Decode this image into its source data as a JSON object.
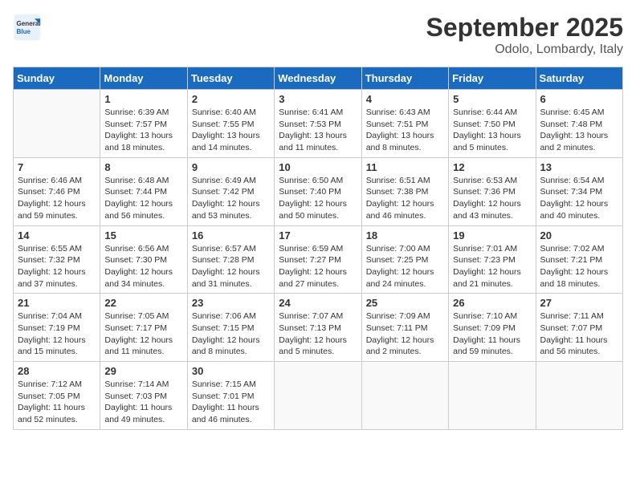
{
  "header": {
    "logo_general": "General",
    "logo_blue": "Blue",
    "month_title": "September 2025",
    "location": "Odolo, Lombardy, Italy"
  },
  "days_of_week": [
    "Sunday",
    "Monday",
    "Tuesday",
    "Wednesday",
    "Thursday",
    "Friday",
    "Saturday"
  ],
  "weeks": [
    [
      {
        "day": "",
        "info": ""
      },
      {
        "day": "1",
        "info": "Sunrise: 6:39 AM\nSunset: 7:57 PM\nDaylight: 13 hours\nand 18 minutes."
      },
      {
        "day": "2",
        "info": "Sunrise: 6:40 AM\nSunset: 7:55 PM\nDaylight: 13 hours\nand 14 minutes."
      },
      {
        "day": "3",
        "info": "Sunrise: 6:41 AM\nSunset: 7:53 PM\nDaylight: 13 hours\nand 11 minutes."
      },
      {
        "day": "4",
        "info": "Sunrise: 6:43 AM\nSunset: 7:51 PM\nDaylight: 13 hours\nand 8 minutes."
      },
      {
        "day": "5",
        "info": "Sunrise: 6:44 AM\nSunset: 7:50 PM\nDaylight: 13 hours\nand 5 minutes."
      },
      {
        "day": "6",
        "info": "Sunrise: 6:45 AM\nSunset: 7:48 PM\nDaylight: 13 hours\nand 2 minutes."
      }
    ],
    [
      {
        "day": "7",
        "info": "Sunrise: 6:46 AM\nSunset: 7:46 PM\nDaylight: 12 hours\nand 59 minutes."
      },
      {
        "day": "8",
        "info": "Sunrise: 6:48 AM\nSunset: 7:44 PM\nDaylight: 12 hours\nand 56 minutes."
      },
      {
        "day": "9",
        "info": "Sunrise: 6:49 AM\nSunset: 7:42 PM\nDaylight: 12 hours\nand 53 minutes."
      },
      {
        "day": "10",
        "info": "Sunrise: 6:50 AM\nSunset: 7:40 PM\nDaylight: 12 hours\nand 50 minutes."
      },
      {
        "day": "11",
        "info": "Sunrise: 6:51 AM\nSunset: 7:38 PM\nDaylight: 12 hours\nand 46 minutes."
      },
      {
        "day": "12",
        "info": "Sunrise: 6:53 AM\nSunset: 7:36 PM\nDaylight: 12 hours\nand 43 minutes."
      },
      {
        "day": "13",
        "info": "Sunrise: 6:54 AM\nSunset: 7:34 PM\nDaylight: 12 hours\nand 40 minutes."
      }
    ],
    [
      {
        "day": "14",
        "info": "Sunrise: 6:55 AM\nSunset: 7:32 PM\nDaylight: 12 hours\nand 37 minutes."
      },
      {
        "day": "15",
        "info": "Sunrise: 6:56 AM\nSunset: 7:30 PM\nDaylight: 12 hours\nand 34 minutes."
      },
      {
        "day": "16",
        "info": "Sunrise: 6:57 AM\nSunset: 7:28 PM\nDaylight: 12 hours\nand 31 minutes."
      },
      {
        "day": "17",
        "info": "Sunrise: 6:59 AM\nSunset: 7:27 PM\nDaylight: 12 hours\nand 27 minutes."
      },
      {
        "day": "18",
        "info": "Sunrise: 7:00 AM\nSunset: 7:25 PM\nDaylight: 12 hours\nand 24 minutes."
      },
      {
        "day": "19",
        "info": "Sunrise: 7:01 AM\nSunset: 7:23 PM\nDaylight: 12 hours\nand 21 minutes."
      },
      {
        "day": "20",
        "info": "Sunrise: 7:02 AM\nSunset: 7:21 PM\nDaylight: 12 hours\nand 18 minutes."
      }
    ],
    [
      {
        "day": "21",
        "info": "Sunrise: 7:04 AM\nSunset: 7:19 PM\nDaylight: 12 hours\nand 15 minutes."
      },
      {
        "day": "22",
        "info": "Sunrise: 7:05 AM\nSunset: 7:17 PM\nDaylight: 12 hours\nand 11 minutes."
      },
      {
        "day": "23",
        "info": "Sunrise: 7:06 AM\nSunset: 7:15 PM\nDaylight: 12 hours\nand 8 minutes."
      },
      {
        "day": "24",
        "info": "Sunrise: 7:07 AM\nSunset: 7:13 PM\nDaylight: 12 hours\nand 5 minutes."
      },
      {
        "day": "25",
        "info": "Sunrise: 7:09 AM\nSunset: 7:11 PM\nDaylight: 12 hours\nand 2 minutes."
      },
      {
        "day": "26",
        "info": "Sunrise: 7:10 AM\nSunset: 7:09 PM\nDaylight: 11 hours\nand 59 minutes."
      },
      {
        "day": "27",
        "info": "Sunrise: 7:11 AM\nSunset: 7:07 PM\nDaylight: 11 hours\nand 56 minutes."
      }
    ],
    [
      {
        "day": "28",
        "info": "Sunrise: 7:12 AM\nSunset: 7:05 PM\nDaylight: 11 hours\nand 52 minutes."
      },
      {
        "day": "29",
        "info": "Sunrise: 7:14 AM\nSunset: 7:03 PM\nDaylight: 11 hours\nand 49 minutes."
      },
      {
        "day": "30",
        "info": "Sunrise: 7:15 AM\nSunset: 7:01 PM\nDaylight: 11 hours\nand 46 minutes."
      },
      {
        "day": "",
        "info": ""
      },
      {
        "day": "",
        "info": ""
      },
      {
        "day": "",
        "info": ""
      },
      {
        "day": "",
        "info": ""
      }
    ]
  ]
}
